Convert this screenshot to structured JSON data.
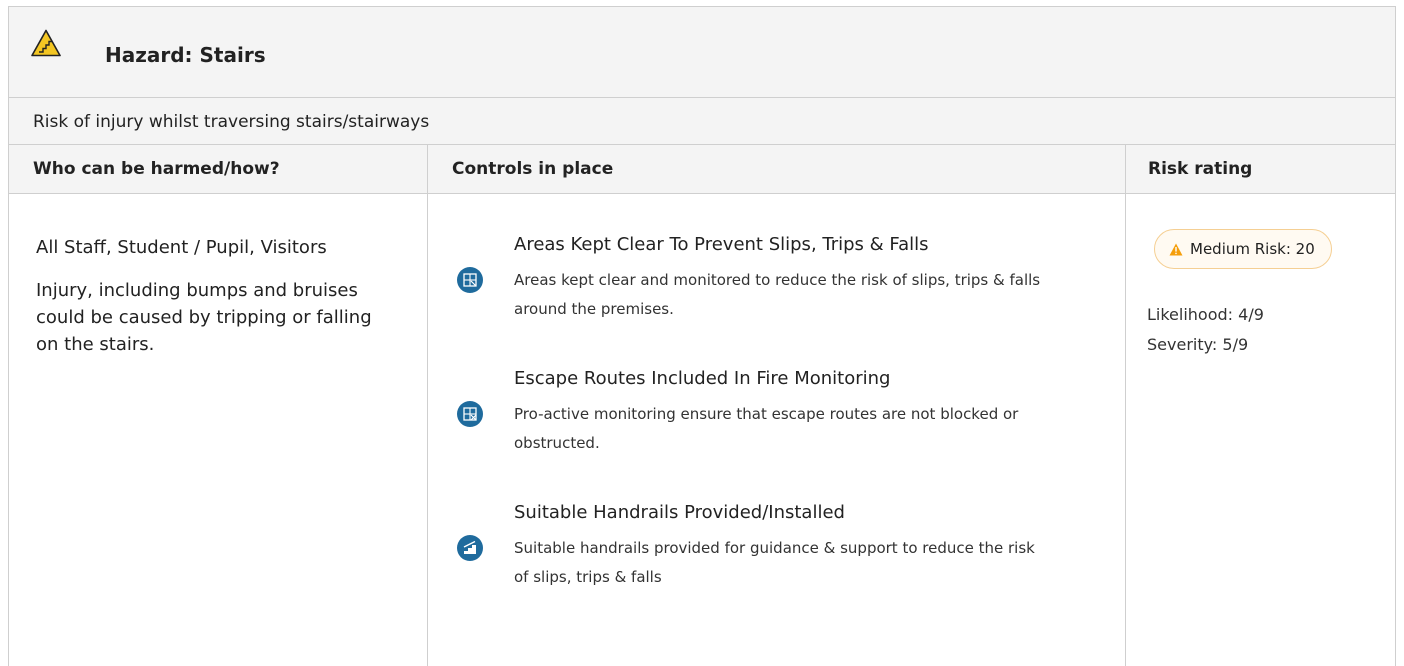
{
  "hazard": {
    "title": "Hazard:  Stairs",
    "description": "Risk of injury whilst traversing stairs/stairways",
    "icon": "stairs-warning-icon"
  },
  "table": {
    "headers": [
      "Who can be harmed/how?",
      "Controls in place",
      "Risk rating"
    ],
    "who": {
      "groups": "All Staff, Student / Pupil, Visitors",
      "harm": "Injury, including bumps and bruises could be caused by tripping or falling on the stairs."
    },
    "controls": [
      {
        "title": "Areas Kept Clear To Prevent Slips, Trips & Falls",
        "body": "Areas kept clear and monitored to reduce the risk of slips, trips & falls around the premises.",
        "icon": "blocked-area-icon"
      },
      {
        "title": "Escape Routes Included In Fire Monitoring",
        "body": "Pro-active monitoring ensure that escape routes are not blocked or obstructed.",
        "icon": "escape-route-icon"
      },
      {
        "title": "Suitable Handrails Provided/Installed",
        "body": "Suitable handrails provided for guidance & support to reduce the risk of slips, trips & falls",
        "icon": "handrail-icon"
      }
    ],
    "risk": {
      "label": "Medium Risk: 20",
      "likelihood": "Likelihood: 4/9",
      "severity": "Severity: 5/9",
      "color": "#f59e0b"
    }
  },
  "colors": {
    "accent_blue": "#1f6b9d",
    "header_bg": "#f4f4f4",
    "border": "#cfcfcf",
    "warning": "#f59e0b"
  }
}
